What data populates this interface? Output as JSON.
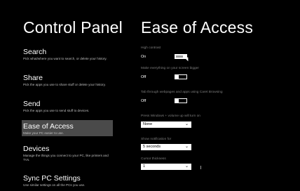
{
  "left_title": "Control Panel",
  "right_title": "Ease of Access",
  "nav": [
    {
      "label": "Search",
      "desc": "Pick what/where you want to search, or delete your history.",
      "selected": false
    },
    {
      "label": "Share",
      "desc": "Pick the apps you use to share stuff or delete your history.",
      "selected": false
    },
    {
      "label": "Send",
      "desc": "Pick the apps you use to send stuff to devices.",
      "selected": false
    },
    {
      "label": "Ease of Access",
      "desc": "Make your PC easier to use.",
      "selected": true
    },
    {
      "label": "Devices",
      "desc": "Manage the things you connect to your PC, like printers and TVs.",
      "selected": false
    },
    {
      "label": "Sync PC Settings",
      "desc": "Use similar settings on all the PCs you use.",
      "selected": false
    }
  ],
  "settings": {
    "high_contrast": {
      "label": "High contrast",
      "state": "On",
      "value": true
    },
    "bigger": {
      "label": "Make everything on your screen bigger",
      "state": "Off",
      "value": false
    },
    "caret": {
      "label": "Tab through webpages and apps using Caret Browsing",
      "state": "Off",
      "value": false
    },
    "press_windows": {
      "label": "Press Windows + volume up will turn on",
      "value": "None"
    },
    "notification": {
      "label": "Show notification for",
      "value": "5 seconds"
    },
    "cursor": {
      "label": "Cursor thickness",
      "value": "1"
    }
  },
  "chevron": "⌄",
  "colors": {
    "background": "#000000",
    "selected": "#4a4a4a",
    "label": "#7f7f7f",
    "text": "#ffffff"
  }
}
